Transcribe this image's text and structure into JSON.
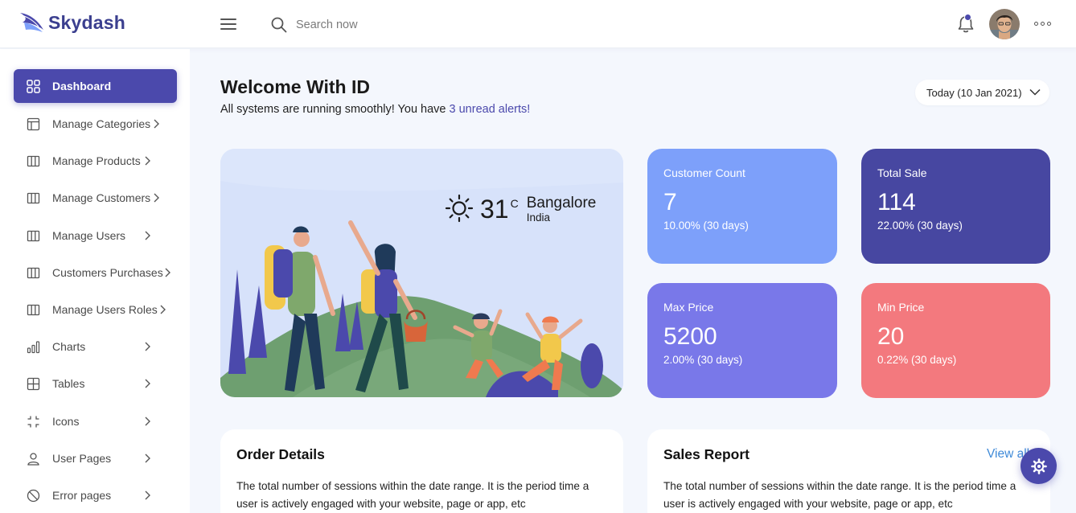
{
  "brand": {
    "name": "Skydash",
    "accent": "#4b49ac"
  },
  "header": {
    "search_placeholder": "Search now",
    "icons": [
      "menu-icon",
      "search-icon",
      "bell-icon",
      "more-icon"
    ]
  },
  "sidebar": {
    "items": [
      {
        "label": "Dashboard",
        "icon": "grid-icon",
        "active": true
      },
      {
        "label": "Manage Categories",
        "icon": "layout-icon",
        "arrow": true
      },
      {
        "label": "Manage Products",
        "icon": "columns-icon",
        "arrow": true
      },
      {
        "label": "Manage Customers",
        "icon": "columns-icon",
        "arrow": true
      },
      {
        "label": "Manage Users",
        "icon": "columns-icon",
        "arrow": true
      },
      {
        "label": "Customers Purchases",
        "icon": "columns-icon",
        "arrow": true
      },
      {
        "label": "Manage Users Roles",
        "icon": "columns-icon",
        "arrow": true
      },
      {
        "label": "Charts",
        "icon": "bar-chart-icon",
        "arrow": true
      },
      {
        "label": "Tables",
        "icon": "table-icon",
        "arrow": true
      },
      {
        "label": "Icons",
        "icon": "corners-icon",
        "arrow": true
      },
      {
        "label": "User Pages",
        "icon": "user-icon",
        "arrow": true
      },
      {
        "label": "Error pages",
        "icon": "ban-icon",
        "arrow": true
      }
    ]
  },
  "main": {
    "title": "Welcome With ID",
    "subtitle_prefix": "All systems are running smoothly! You have ",
    "subtitle_link": "3 unread alerts!",
    "date_label": "Today (10 Jan 2021)",
    "weather": {
      "temp": "31",
      "unit": "C",
      "city": "Bangalore",
      "country": "India"
    },
    "stats": [
      {
        "label": "Customer Count",
        "value": "7",
        "delta": "10.00% (30 days)",
        "color": "#7da0fa"
      },
      {
        "label": "Total Sale",
        "value": "114",
        "delta": "22.00% (30 days)",
        "color": "#4747a1"
      },
      {
        "label": "Max Price",
        "value": "5200",
        "delta": "2.00% (30 days)",
        "color": "#7978e9"
      },
      {
        "label": "Min Price",
        "value": "20",
        "delta": "0.22% (30 days)",
        "color": "#f3797e"
      }
    ],
    "order_details": {
      "title": "Order Details",
      "text": "The total number of sessions within the date range. It is the period time a user is actively engaged with your website, page or app, etc"
    },
    "sales_report": {
      "title": "Sales Report",
      "view_all": "View all",
      "text": "The total number of sessions within the date range. It is the period time a user is actively engaged with your website, page or app, etc"
    }
  }
}
